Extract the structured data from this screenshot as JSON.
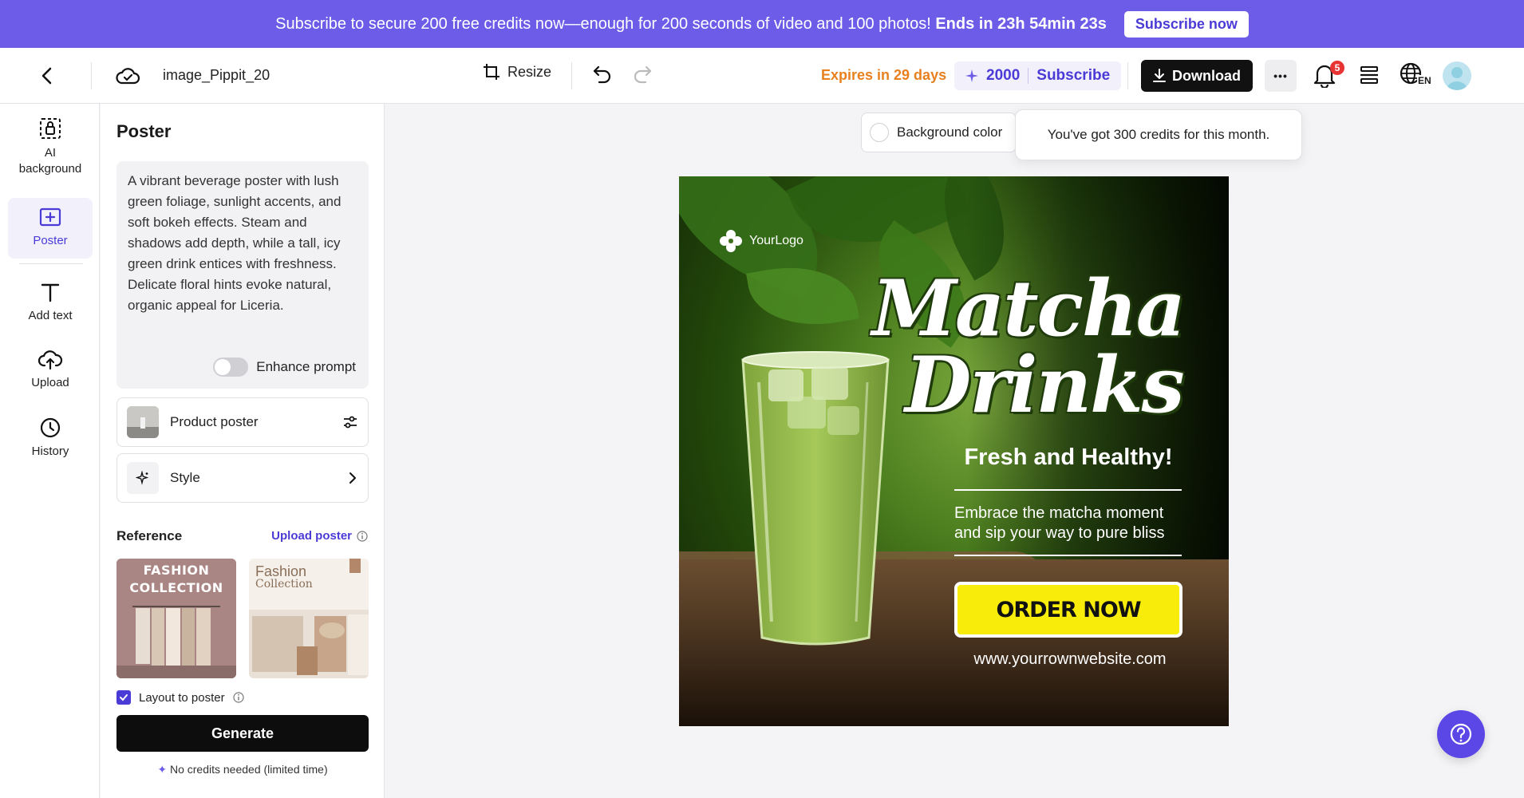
{
  "promo": {
    "text": "Subscribe to secure 200 free credits now—enough for 200 seconds of video and 100 photos!",
    "countdown": "Ends in 23h 54min 23s",
    "button": "Subscribe now"
  },
  "topbar": {
    "title": "image_Pippit_20",
    "resize": "Resize",
    "expires": "Expires in 29 days",
    "credits": "2000",
    "subscribe": "Subscribe",
    "download": "Download",
    "more": "•••",
    "badge": "5",
    "lang": "EN"
  },
  "rail": {
    "items": [
      {
        "label": "AI background",
        "icon": "ai-background-icon"
      },
      {
        "label": "Poster",
        "icon": "poster-icon"
      },
      {
        "label": "Add text",
        "icon": "text-icon"
      },
      {
        "label": "Upload",
        "icon": "upload-icon"
      },
      {
        "label": "History",
        "icon": "history-icon"
      }
    ]
  },
  "panel": {
    "title": "Poster",
    "prompt": "A vibrant beverage poster with lush green foliage, sunlight accents, and soft bokeh effects. Steam and shadows add depth, while a tall, icy green drink entices with freshness. Delicate floral hints evoke natural, organic appeal for Liceria.",
    "enhance": "Enhance prompt",
    "product_poster": "Product poster",
    "style": "Style",
    "reference": "Reference",
    "upload_poster": "Upload poster",
    "ref1_line1": "FASHION",
    "ref1_line2": "COLLECTION",
    "ref2_line1": "Fashion",
    "ref2_line2": "Collection",
    "layout_to_poster": "Layout to poster",
    "generate": "Generate",
    "no_credits": "No credits needed (limited time)"
  },
  "canvas": {
    "background_color": "Background color",
    "tooltip": "You've got 300 credits for this month."
  },
  "poster": {
    "logo": "YourLogo",
    "title_line1": "Matcha",
    "title_line2": "Drinks",
    "subtitle": "Fresh and Healthy!",
    "tagline": "Embrace the matcha moment and sip your way to pure bliss",
    "cta": "ORDER NOW",
    "website": "www.yourrownwebsite.com"
  },
  "colors": {
    "accent": "#6d5ce8",
    "expires": "#e8801f",
    "cta": "#f8ec0a"
  }
}
